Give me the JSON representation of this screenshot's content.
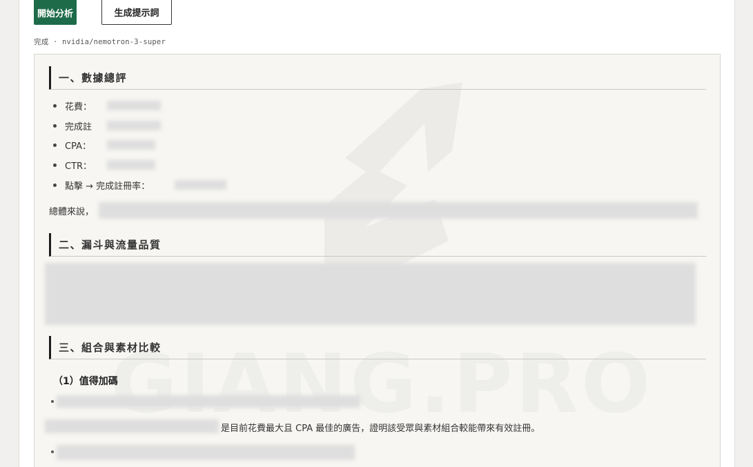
{
  "toolbar": {
    "analyze_label": "開始分析",
    "prompt_label": "生成提示詞"
  },
  "status": {
    "text": "完成 · nvidia/nemotron-3-super"
  },
  "report": {
    "section1": {
      "title": "一、數據總評",
      "items": [
        "花費：",
        "完成註",
        "CPA：",
        "CTR：",
        "點擊 → 完成註冊率："
      ],
      "summary_prefix": "總體來說，"
    },
    "section2": {
      "title": "二、漏斗與流量品質"
    },
    "section3": {
      "title": "三、組合與素材比較",
      "sub1_title": "（1）值得加碼",
      "sub1_paragraph": "是目前花費最大且 CPA 最佳的廣告，證明該受眾與素材組合較能帶來有效註冊。"
    }
  },
  "watermark": {
    "text": "GIANG.PRO"
  }
}
